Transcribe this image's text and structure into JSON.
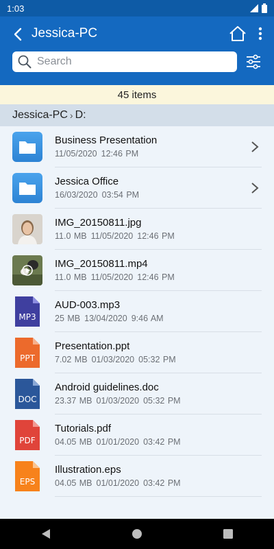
{
  "status_bar": {
    "time": "1:03"
  },
  "app_bar": {
    "title": "Jessica-PC",
    "search_placeholder": "Search"
  },
  "item_count": "45 items",
  "breadcrumb": [
    "Jessica-PC",
    "D:"
  ],
  "files": [
    {
      "name": "Business Presentation",
      "size": "",
      "date": "11/05/2020",
      "time": "12:46 PM",
      "type": "folder"
    },
    {
      "name": "Jessica Office",
      "size": "",
      "date": "16/03/2020",
      "time": "03:54 PM",
      "type": "folder"
    },
    {
      "name": "IMG_20150811.jpg",
      "size": "11.0 MB",
      "date": "11/05/2020",
      "time": "12:46 PM",
      "type": "image"
    },
    {
      "name": "IMG_20150811.mp4",
      "size": "11.0 MB",
      "date": "11/05/2020",
      "time": "12:46 PM",
      "type": "video"
    },
    {
      "name": "AUD-003.mp3",
      "size": "25 MB",
      "date": "13/04/2020",
      "time": "9:46 AM",
      "type": "file",
      "badge": "MP3",
      "color": "#3f3f9f"
    },
    {
      "name": "Presentation.ppt",
      "size": "7.02 MB",
      "date": "01/03/2020",
      "time": "05:32 PM",
      "type": "file",
      "badge": "PPT",
      "color": "#ec6a2c"
    },
    {
      "name": "Android guidelines.doc",
      "size": "23.37 MB",
      "date": "01/03/2020",
      "time": "05:32 PM",
      "type": "file",
      "badge": "DOC",
      "color": "#2b579a"
    },
    {
      "name": "Tutorials.pdf",
      "size": "04.05 MB",
      "date": "01/01/2020",
      "time": "03:42 PM",
      "type": "file",
      "badge": "PDF",
      "color": "#e0443a"
    },
    {
      "name": "Illustration.eps",
      "size": "04.05 MB",
      "date": "01/01/2020",
      "time": "03:42 PM",
      "type": "file",
      "badge": "EPS",
      "color": "#f7821b"
    }
  ],
  "colors": {
    "app_bar": "#1469c0",
    "status_bar": "#0e5ba6",
    "count_bar": "#fbf6dc",
    "breadcrumb_bar": "#d3dee9",
    "list_background": "#eef4fa"
  }
}
